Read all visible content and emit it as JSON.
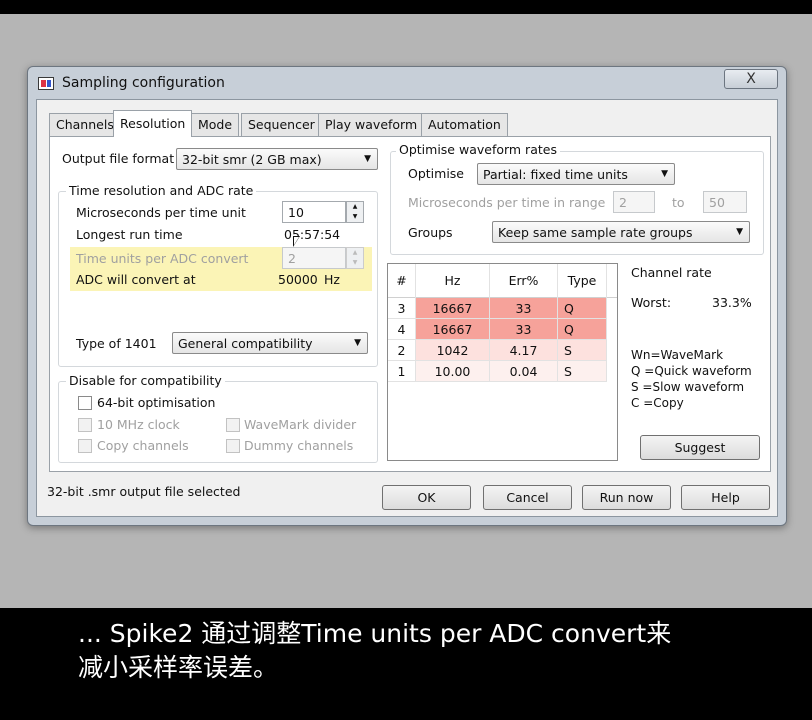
{
  "window": {
    "title": "Sampling configuration",
    "close_label": "X"
  },
  "tabs": [
    {
      "label": "Channels",
      "active": false
    },
    {
      "label": "Resolution",
      "active": true
    },
    {
      "label": "Mode",
      "active": false
    },
    {
      "label": "Sequencer",
      "active": false
    },
    {
      "label": "Play waveform",
      "active": false
    },
    {
      "label": "Automation",
      "active": false
    }
  ],
  "output_format": {
    "label": "Output file format",
    "value": "32-bit smr (2 GB max)"
  },
  "time_resolution": {
    "group_title": "Time resolution and ADC rate",
    "microseconds_label": "Microseconds per time unit",
    "microseconds_value": "10",
    "longest_run_label": "Longest run time",
    "longest_run_value": "05:57:54",
    "units_per_adc_label": "Time units per ADC convert",
    "units_per_adc_value": "2",
    "adc_convert_label": "ADC will convert at",
    "adc_convert_value": "50000",
    "adc_convert_unit": "Hz"
  },
  "type_1401": {
    "label": "Type of 1401",
    "value": "General compatibility"
  },
  "compat": {
    "group_title": "Disable for compatibility",
    "opt_64bit": "64-bit optimisation",
    "opt_10mhz": "10 MHz clock",
    "opt_wavemark": "WaveMark divider",
    "opt_copy": "Copy channels",
    "opt_dummy": "Dummy channels"
  },
  "optimise": {
    "group_title": "Optimise waveform rates",
    "optimise_label": "Optimise",
    "optimise_value": "Partial: fixed time units",
    "range_label": "Microseconds per time in range",
    "range_from": "2",
    "range_to_label": "to",
    "range_to": "50",
    "groups_label": "Groups",
    "groups_value": "Keep same sample rate groups"
  },
  "rates_table": {
    "headers": [
      "#",
      "Hz",
      "Err%",
      "Type"
    ],
    "rows": [
      {
        "num": "3",
        "hz": "16667",
        "err": "33",
        "type": "Q",
        "bg": "#f6a29a"
      },
      {
        "num": "4",
        "hz": "16667",
        "err": "33",
        "type": "Q",
        "bg": "#f6a29a"
      },
      {
        "num": "2",
        "hz": "1042",
        "err": "4.17",
        "type": "S",
        "bg": "#fde1de"
      },
      {
        "num": "1",
        "hz": "10.00",
        "err": "0.04",
        "type": "S",
        "bg": "#fdf0ee"
      }
    ]
  },
  "channel_rate": {
    "title": "Channel rate",
    "worst_label": "Worst:",
    "worst_value": "33.3%",
    "legend": [
      "Wn=WaveMark",
      "Q =Quick waveform",
      "S =Slow waveform",
      "C =Copy"
    ],
    "suggest_label": "Suggest"
  },
  "status_text": "32-bit .smr output file selected",
  "buttons": {
    "ok": "OK",
    "cancel": "Cancel",
    "run_now": "Run now",
    "help": "Help"
  },
  "subtitle": {
    "line1": "... Spike2 通过调整Time units per ADC convert来",
    "line2": "减小采样率误差。"
  }
}
